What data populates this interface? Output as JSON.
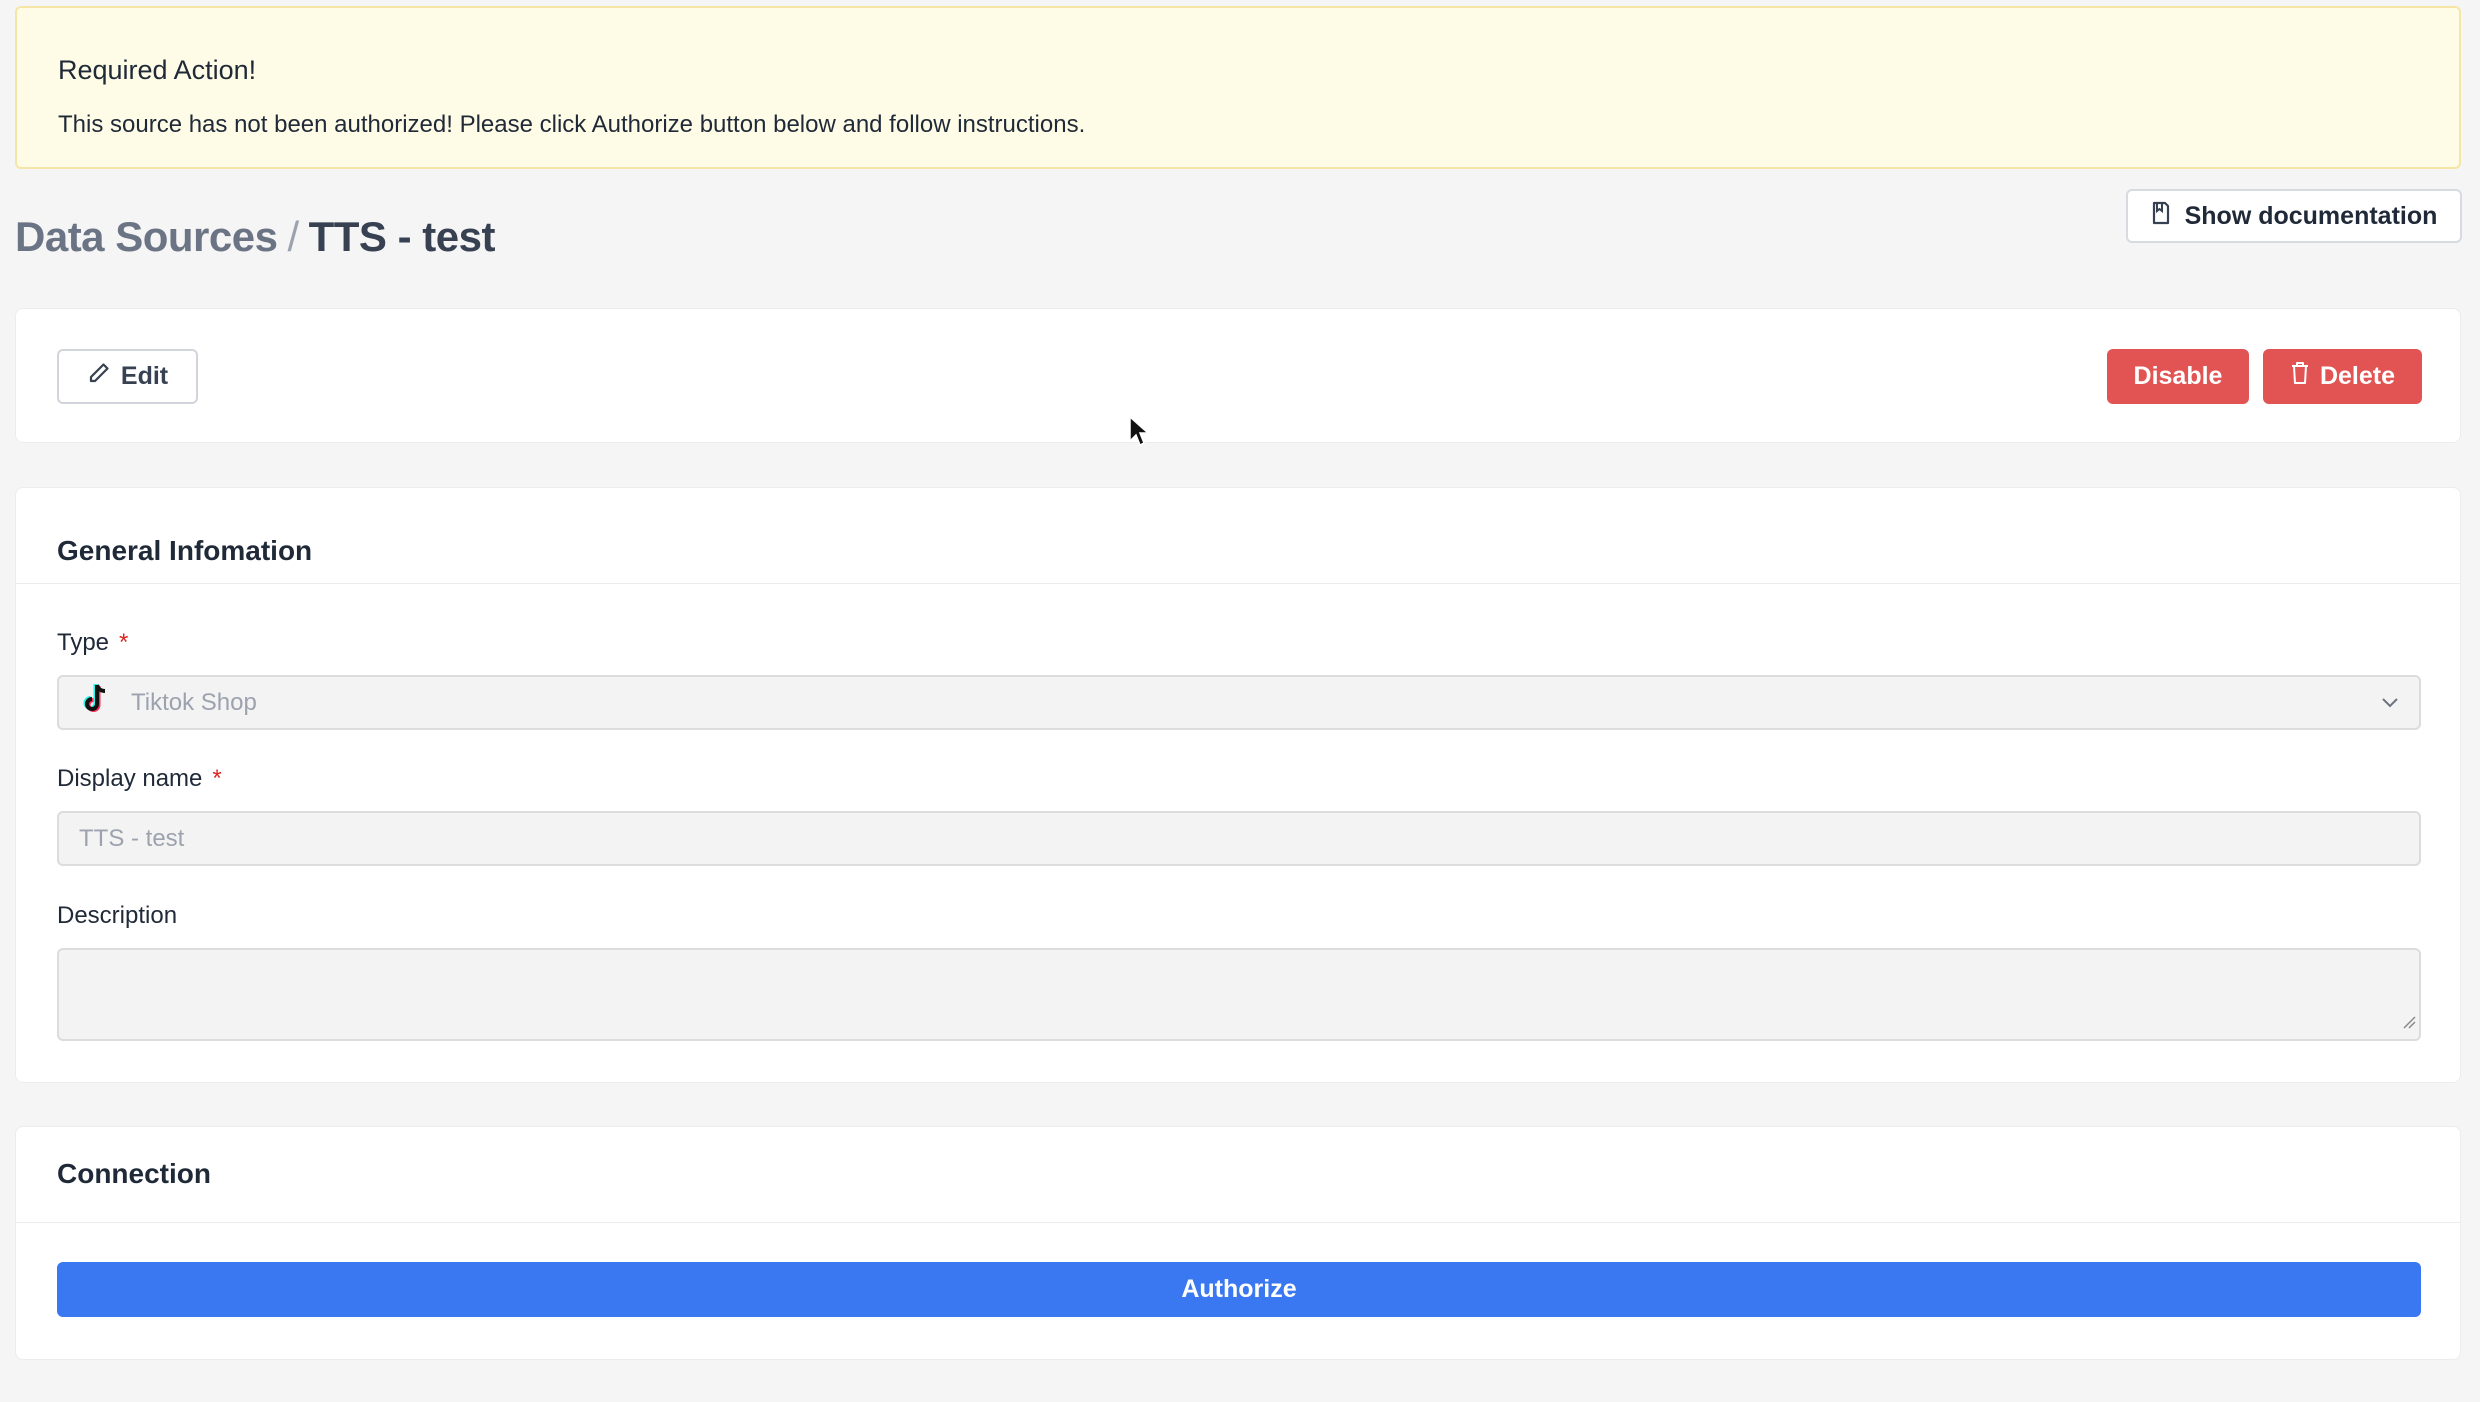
{
  "alert": {
    "title": "Required Action!",
    "message": "This source has not been authorized! Please click Authorize button below and follow instructions."
  },
  "breadcrumb": {
    "parent": "Data Sources",
    "separator": "/",
    "current": "TTS - test"
  },
  "header": {
    "doc_button_label": "Show documentation",
    "doc_icon": "document-icon"
  },
  "actions": {
    "edit_label": "Edit",
    "edit_icon": "pencil-icon",
    "disable_label": "Disable",
    "delete_label": "Delete",
    "delete_icon": "trash-icon"
  },
  "general": {
    "heading": "General Infomation",
    "type_label": "Type",
    "type_value": "Tiktok Shop",
    "type_icon": "tiktok-icon",
    "display_name_label": "Display name",
    "display_name_value": "TTS - test",
    "description_label": "Description",
    "description_value": "",
    "required_mark": "*"
  },
  "connection": {
    "heading": "Connection",
    "authorize_label": "Authorize"
  },
  "colors": {
    "danger": "#e25454",
    "primary": "#3a78f2",
    "alert_bg": "#fefce6",
    "page_bg": "#f5f5f5"
  }
}
